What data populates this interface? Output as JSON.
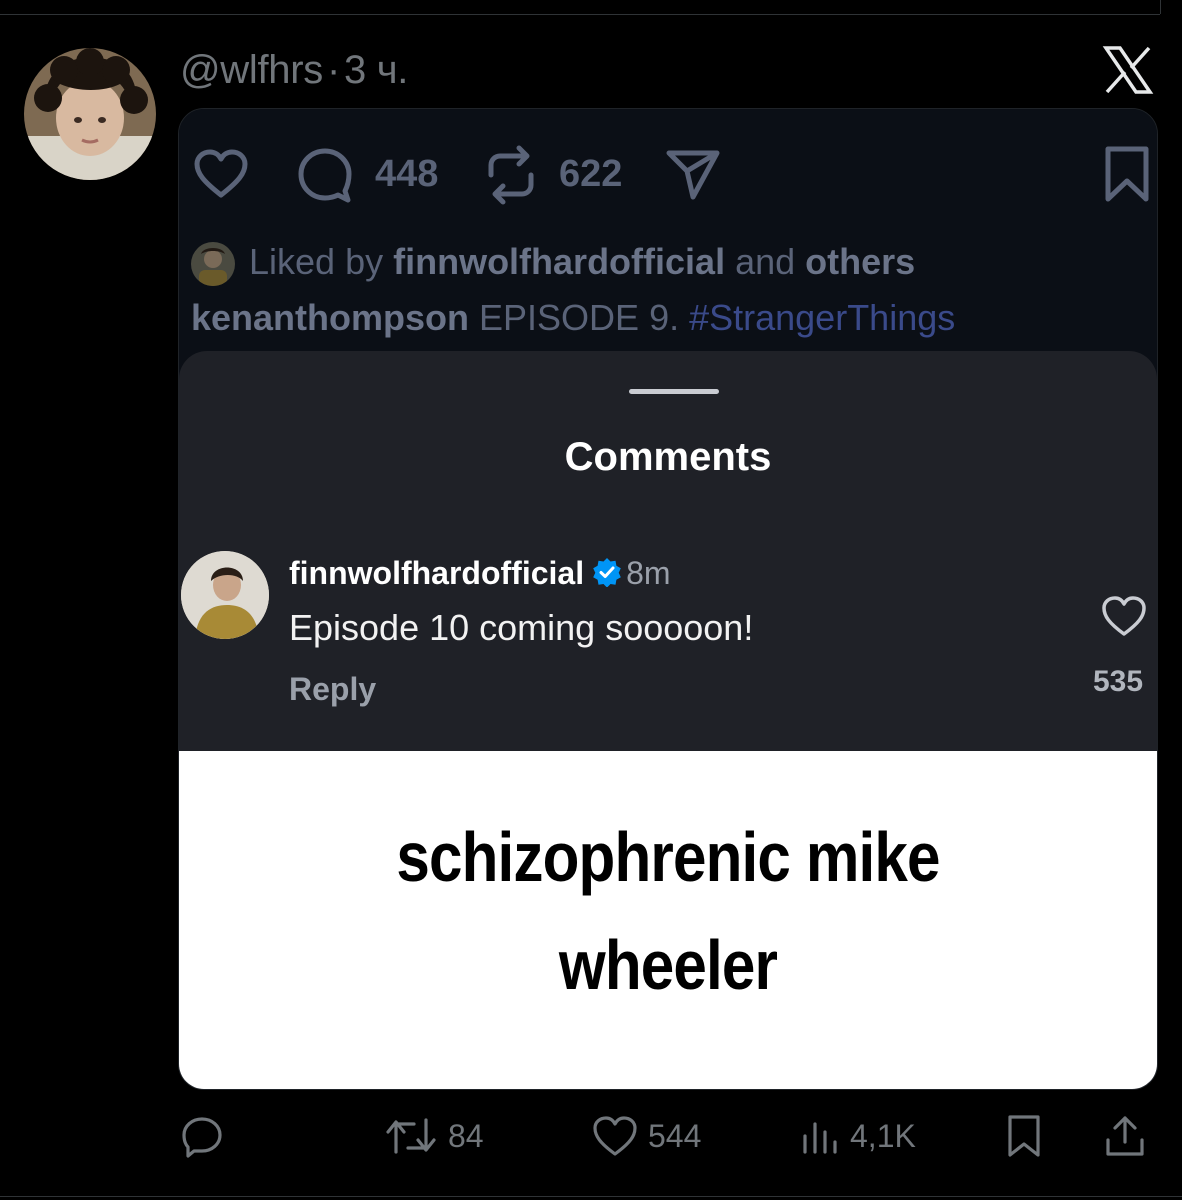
{
  "tweet": {
    "handle": "@wlfhrs",
    "separator": "·",
    "time": "3 ч."
  },
  "embedded_post": {
    "comments_count": "448",
    "reposts_count": "622",
    "liked_by_prefix": "Liked by ",
    "liked_by_user": "finnwolfhardofficial",
    "liked_by_and": " and ",
    "liked_by_others": "others",
    "caption_user": "kenanthompson",
    "caption_text": " EPISODE 9. ",
    "caption_hashtag": "#StrangerThings"
  },
  "comments_sheet": {
    "title": "Comments",
    "comment": {
      "username": "finnwolfhardofficial",
      "time": "8m",
      "text": "Episode 10 coming sooooon!",
      "reply_label": "Reply",
      "likes": "535"
    }
  },
  "meme": {
    "line1": "schizophrenic mike",
    "line2": "wheeler"
  },
  "actions": {
    "reposts": "84",
    "likes": "544",
    "views": "4,1K"
  },
  "colors": {
    "background": "#000000",
    "muted": "#71767b",
    "verified": "#0095f6"
  },
  "icons": [
    "close-x-icon",
    "heart-icon",
    "comment-icon",
    "repost-icon",
    "share-icon",
    "bookmark-icon",
    "verified-icon",
    "views-icon",
    "upload-icon"
  ]
}
